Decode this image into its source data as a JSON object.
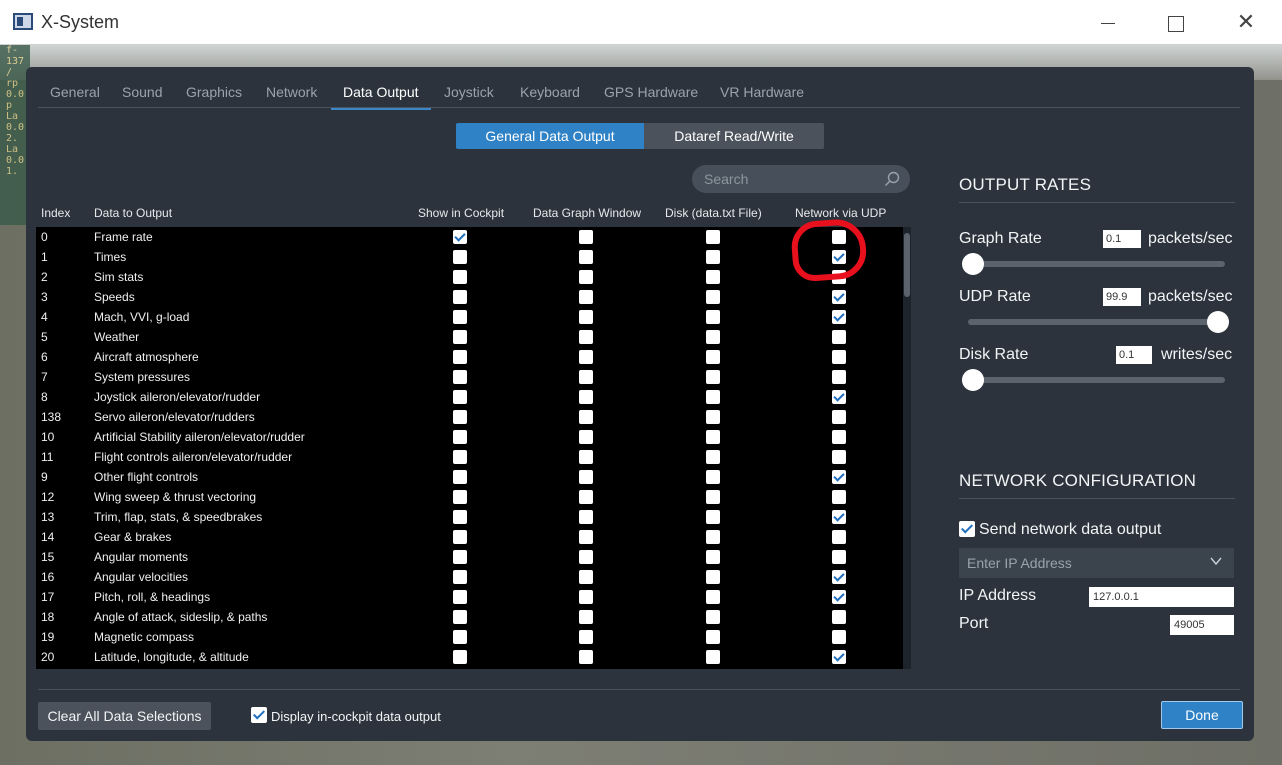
{
  "window": {
    "title": "X-System"
  },
  "background_readout": [
    "f-",
    "137",
    "/",
    "rp",
    "0.0",
    "p",
    "La",
    "0.0",
    "2.",
    "La",
    "0.0",
    "1."
  ],
  "tabs": [
    {
      "label": "General"
    },
    {
      "label": "Sound"
    },
    {
      "label": "Graphics"
    },
    {
      "label": "Network"
    },
    {
      "label": "Data Output",
      "active": true
    },
    {
      "label": "Joystick"
    },
    {
      "label": "Keyboard"
    },
    {
      "label": "GPS Hardware"
    },
    {
      "label": "VR Hardware"
    }
  ],
  "segments": {
    "general": "General Data Output",
    "dataref": "Dataref Read/Write",
    "active": "general"
  },
  "search": {
    "placeholder": "Search"
  },
  "columns": {
    "index": "Index",
    "data": "Data to Output",
    "cockpit": "Show in Cockpit",
    "graph": "Data Graph Window",
    "disk": "Disk (data.txt File)",
    "udp": "Network via UDP"
  },
  "rows": [
    {
      "index": "0",
      "name": "Frame rate",
      "cockpit": true,
      "graph": false,
      "disk": false,
      "udp": false
    },
    {
      "index": "1",
      "name": "Times",
      "cockpit": false,
      "graph": false,
      "disk": false,
      "udp": true
    },
    {
      "index": "2",
      "name": "Sim stats",
      "cockpit": false,
      "graph": false,
      "disk": false,
      "udp": false
    },
    {
      "index": "3",
      "name": "Speeds",
      "cockpit": false,
      "graph": false,
      "disk": false,
      "udp": true
    },
    {
      "index": "4",
      "name": "Mach, VVI, g-load",
      "cockpit": false,
      "graph": false,
      "disk": false,
      "udp": true
    },
    {
      "index": "5",
      "name": "Weather",
      "cockpit": false,
      "graph": false,
      "disk": false,
      "udp": false
    },
    {
      "index": "6",
      "name": "Aircraft atmosphere",
      "cockpit": false,
      "graph": false,
      "disk": false,
      "udp": false
    },
    {
      "index": "7",
      "name": "System pressures",
      "cockpit": false,
      "graph": false,
      "disk": false,
      "udp": false
    },
    {
      "index": "8",
      "name": "Joystick aileron/elevator/rudder",
      "cockpit": false,
      "graph": false,
      "disk": false,
      "udp": true
    },
    {
      "index": "138",
      "name": "Servo aileron/elevator/rudders",
      "cockpit": false,
      "graph": false,
      "disk": false,
      "udp": false
    },
    {
      "index": "10",
      "name": "Artificial Stability aileron/elevator/rudder",
      "cockpit": false,
      "graph": false,
      "disk": false,
      "udp": false
    },
    {
      "index": "11",
      "name": "Flight controls aileron/elevator/rudder",
      "cockpit": false,
      "graph": false,
      "disk": false,
      "udp": false
    },
    {
      "index": "9",
      "name": "Other flight controls",
      "cockpit": false,
      "graph": false,
      "disk": false,
      "udp": true
    },
    {
      "index": "12",
      "name": "Wing sweep & thrust vectoring",
      "cockpit": false,
      "graph": false,
      "disk": false,
      "udp": false
    },
    {
      "index": "13",
      "name": "Trim, flap, stats, & speedbrakes",
      "cockpit": false,
      "graph": false,
      "disk": false,
      "udp": true
    },
    {
      "index": "14",
      "name": "Gear & brakes",
      "cockpit": false,
      "graph": false,
      "disk": false,
      "udp": false
    },
    {
      "index": "15",
      "name": "Angular moments",
      "cockpit": false,
      "graph": false,
      "disk": false,
      "udp": false
    },
    {
      "index": "16",
      "name": "Angular velocities",
      "cockpit": false,
      "graph": false,
      "disk": false,
      "udp": true
    },
    {
      "index": "17",
      "name": "Pitch, roll, & headings",
      "cockpit": false,
      "graph": false,
      "disk": false,
      "udp": true
    },
    {
      "index": "18",
      "name": "Angle of attack, sideslip, & paths",
      "cockpit": false,
      "graph": false,
      "disk": false,
      "udp": false
    },
    {
      "index": "19",
      "name": "Magnetic compass",
      "cockpit": false,
      "graph": false,
      "disk": false,
      "udp": false
    },
    {
      "index": "20",
      "name": "Latitude, longitude, & altitude",
      "cockpit": false,
      "graph": false,
      "disk": false,
      "udp": true
    }
  ],
  "output_rates": {
    "title": "OUTPUT RATES",
    "graph": {
      "label": "Graph Rate",
      "value": "0.1",
      "unit": "packets/sec",
      "level": 0.0
    },
    "udp": {
      "label": "UDP Rate",
      "value": "99.9",
      "unit": "packets/sec",
      "level": 1.0
    },
    "disk": {
      "label": "Disk Rate",
      "value": "0.1",
      "unit": "writes/sec",
      "level": 0.0
    }
  },
  "network": {
    "title": "NETWORK CONFIGURATION",
    "send_label": "Send network data output",
    "send_checked": true,
    "ip_select_placeholder": "Enter IP Address",
    "ip_label": "IP Address",
    "ip_value": "127.0.0.1",
    "port_label": "Port",
    "port_value": "49005"
  },
  "footer": {
    "clear_label": "Clear All Data Selections",
    "display_label": "Display in-cockpit data output",
    "display_checked": true,
    "done_label": "Done"
  },
  "colors": {
    "accent": "#2f82c6",
    "dialog_bg": "#2c333c",
    "annotation": "#e8101c"
  }
}
